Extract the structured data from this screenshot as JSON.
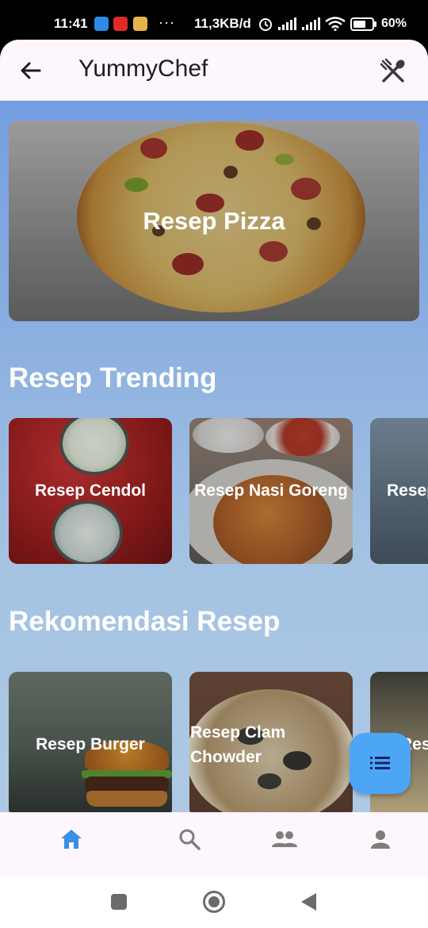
{
  "status_bar": {
    "time": "11:41",
    "dots": "···",
    "network_speed": "11,3KB/d",
    "battery": "60%"
  },
  "app_bar": {
    "title": "YummyChef",
    "back_icon": "arrow-left-icon",
    "action_icon": "utensils-icon"
  },
  "hero": {
    "label": "Resep Pizza"
  },
  "trending": {
    "title": "Resep Trending",
    "items": [
      {
        "label": "Resep Cendol"
      },
      {
        "label": "Resep Nasi Goreng"
      },
      {
        "label": "Resep"
      }
    ]
  },
  "recommendations": {
    "title": "Rekomendasi Resep",
    "items": [
      {
        "label": "Resep Burger"
      },
      {
        "label": "Resep Clam Chowder"
      },
      {
        "label": "Resep"
      }
    ]
  },
  "fab": {
    "icon": "list-icon"
  },
  "bottom_nav": {
    "items": [
      {
        "icon": "home-icon",
        "active": true
      },
      {
        "icon": "search-icon",
        "active": false
      },
      {
        "icon": "group-icon",
        "active": false
      },
      {
        "icon": "person-icon",
        "active": false
      }
    ]
  },
  "colors": {
    "accent": "#4da5f5",
    "nav_active": "#3a8ee6",
    "nav_inactive": "#7d7d7d",
    "app_bar_bg": "#fdf6fc"
  }
}
